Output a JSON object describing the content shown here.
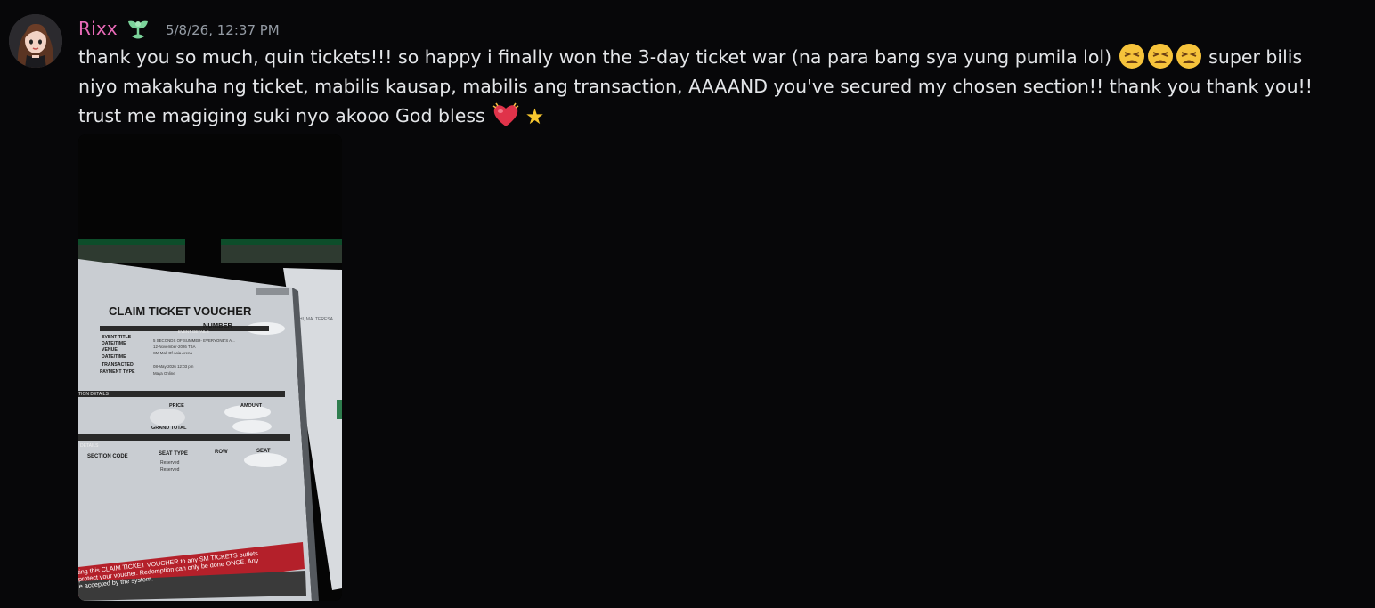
{
  "message": {
    "username": "Rixx",
    "timestamp": "5/8/26, 12:37 PM",
    "text_part1": "thank you so much, quin tickets!!! so happy i finally won the 3-day ticket war (na para bang sya yung pumila lol)",
    "text_part2": "super bilis niyo makakuha ng ticket, mabilis kausap, mabilis ang transaction, AAAAND you've secured my chosen section!! thank you thank you!! trust me magiging suki nyo akooo God bless",
    "emoji_names": [
      "weary-face-emoji",
      "weary-face-emoji",
      "weary-face-emoji",
      "beating-heart-emoji",
      "star-emoji"
    ],
    "star_glyph": "★",
    "colors": {
      "username": "#e86ab7",
      "background": "#070709",
      "timestamp": "#949ba4"
    }
  },
  "attachment": {
    "voucher_title": "CLAIM TICKET VOUCHER",
    "number_label": "NUMBER",
    "event_details_header": "EVENT DETAILS",
    "rows": [
      {
        "label": "EVENT TITLE",
        "value": "5 SECONDS OF SUMMER- EVERYONE'S A..."
      },
      {
        "label": "DATE/TIME",
        "value": "12-November-2026 TBA"
      },
      {
        "label": "VENUE",
        "value": "SM Mall Of Asia Arena"
      },
      {
        "label": "DATE/TIME",
        "value": ""
      },
      {
        "label": "TRANSACTED",
        "value": "08-May-2026 12:03 pm"
      },
      {
        "label": "PAYMENT TYPE",
        "value": "Maya Online"
      }
    ],
    "transaction_details_header": "TION DETAILS",
    "price_label": "PRICE",
    "amount_label": "AMOUNT",
    "grand_total_label": "GRAND TOTAL",
    "seat_details_header": "DETAILS",
    "section_code_label": "SECTION CODE",
    "seat_type_label": "SEAT TYPE",
    "row_label": "ROW",
    "seat_label": "SEAT",
    "reserved_1": "Reserved",
    "reserved_2": "Reserved",
    "side_text": "HI, MA. TERESA",
    "footer_line1": "ting this CLAIM TICKET VOUCHER to any SM TICKETS outlets",
    "footer_line2": "protect your voucher. Redemption can only be done ONCE. Any",
    "footer_line3": "e accepted by the system."
  }
}
